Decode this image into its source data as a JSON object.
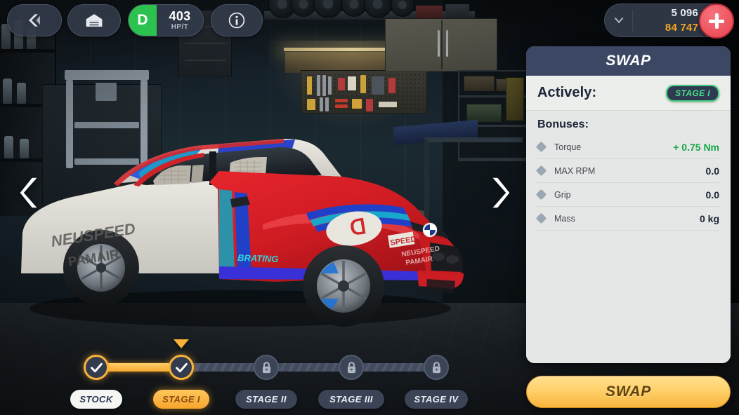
{
  "topbar": {
    "back_icon": "chevron-left-icon",
    "garage_icon": "garage-icon",
    "info_icon": "info-circle-icon",
    "performance": {
      "grade": "D",
      "value": "403",
      "unit": "HP/T"
    },
    "wallet": {
      "chevron_icon": "chevron-down-icon",
      "silver_amount": "5 096",
      "gold_amount": "84 747",
      "silver_icon": "silver-coin-icon",
      "gold_icon": "gold-coin-icon",
      "add_icon": "plus-icon"
    }
  },
  "carousel": {
    "prev_icon": "chevron-left-icon",
    "next_icon": "chevron-right-icon"
  },
  "panel": {
    "title": "SWAP",
    "actively_label": "Actively:",
    "actively_stage": "STAGE I",
    "bonuses_title": "Bonuses:",
    "bonuses": [
      {
        "name": "Torque",
        "value": "+ 0.75 Nm",
        "positive": true
      },
      {
        "name": "MAX RPM",
        "value": "0.0",
        "positive": false
      },
      {
        "name": "Grip",
        "value": "0.0",
        "positive": false
      },
      {
        "name": "Mass",
        "value": "0 kg",
        "positive": false
      }
    ],
    "cta_label": "SWAP"
  },
  "stages": [
    {
      "label": "STOCK",
      "state": "done"
    },
    {
      "label": "STAGE I",
      "state": "active"
    },
    {
      "label": "STAGE II",
      "state": "locked"
    },
    {
      "label": "STAGE III",
      "state": "locked"
    },
    {
      "label": "STAGE IV",
      "state": "locked"
    }
  ],
  "colors": {
    "accent_orange": "#f7a52c",
    "grade_green": "#2cc24f",
    "badge_green": "#46e089",
    "bonus_green": "#16a64a",
    "gold": "#f5a623",
    "panel_header": "#3b4763",
    "add_red": "#e8434f"
  }
}
